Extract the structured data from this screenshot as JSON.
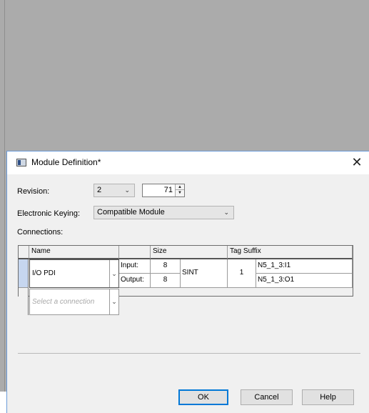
{
  "dialog": {
    "title": "Module Definition*",
    "close_label": "✕"
  },
  "revision": {
    "label": "Revision:",
    "major": "2",
    "minor": "71"
  },
  "keying": {
    "label": "Electronic Keying:",
    "value": "Compatible Module"
  },
  "connections": {
    "label": "Connections:",
    "headers": {
      "name": "Name",
      "size": "Size",
      "tag_suffix": "Tag Suffix"
    },
    "rows": [
      {
        "name": "I/O PDI",
        "input_label": "Input:",
        "input_size": "8",
        "output_label": "Output:",
        "output_size": "8",
        "type": "SINT",
        "tag_count": "1",
        "input_tag": "N5_1_3:I1",
        "output_tag": "N5_1_3:O1"
      }
    ],
    "empty_placeholder": "Select a connection"
  },
  "buttons": {
    "ok": "OK",
    "cancel": "Cancel",
    "help": "Help"
  },
  "icons": {
    "dropdown": "chevron-down-icon",
    "spin_up": "up-arrow-icon",
    "spin_down": "down-arrow-icon",
    "close": "close-icon",
    "app": "module-icon"
  },
  "colors": {
    "selection": "#c6d6ef",
    "default_button_border": "#0078d7",
    "dialog_border": "#6b9bd8"
  }
}
